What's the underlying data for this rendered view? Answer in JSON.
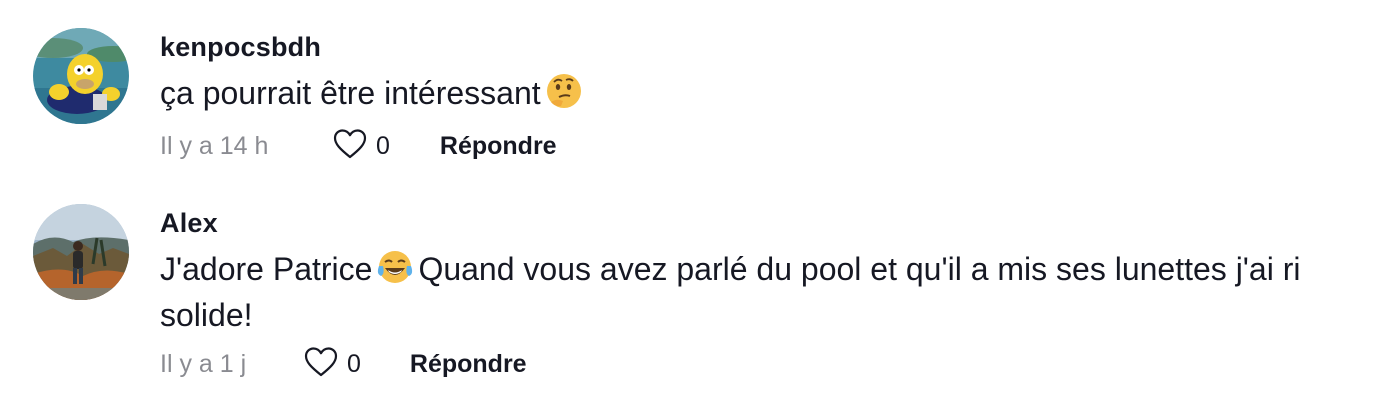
{
  "comments": [
    {
      "username": "kenpocsbdh",
      "text": "ça pourrait être intéressant",
      "emoji_icon": "thinking-face-emoji",
      "time": "Il y a 14 h",
      "likes": "0",
      "reply_label": "Répondre"
    },
    {
      "username": "Alex",
      "text_before": "J'adore Patrice",
      "emoji_icon": "tears-of-joy-emoji",
      "text_after": "Quand vous avez parlé du pool et qu'il a mis ses lunettes j'ai ri solide!",
      "time": "Il y a 1 j",
      "likes": "0",
      "reply_label": "Répondre"
    }
  ],
  "colors": {
    "primary_text": "#161823",
    "secondary_text": "#8a8b91",
    "heart_outline": "#161823"
  }
}
